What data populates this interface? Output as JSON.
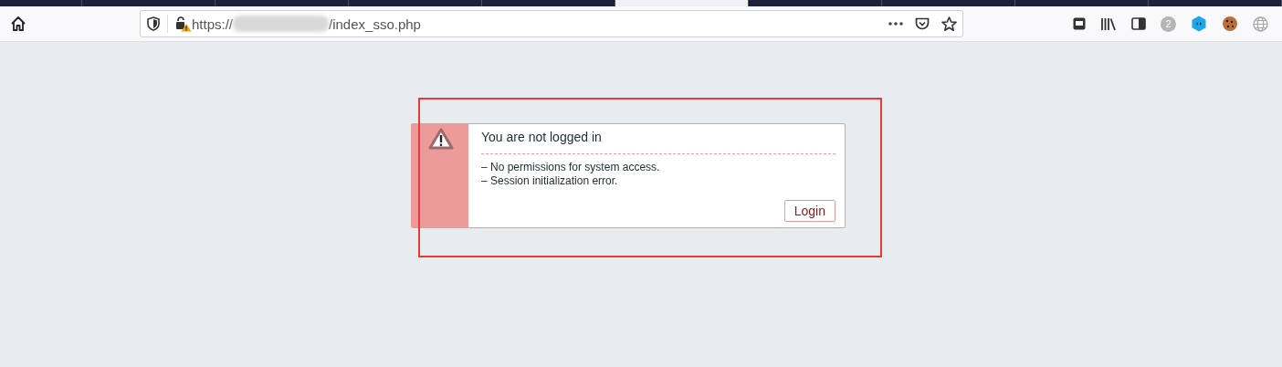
{
  "tabs": [
    {
      "selected": false
    },
    {
      "selected": false
    },
    {
      "selected": false
    },
    {
      "selected": false
    },
    {
      "selected": false
    },
    {
      "selected": true
    },
    {
      "selected": false
    },
    {
      "selected": false
    },
    {
      "selected": false
    },
    {
      "selected": false
    }
  ],
  "address_bar": {
    "url_start": "https://",
    "url_end": "/index_sso.php"
  },
  "toolbar": {
    "badge": "2"
  },
  "alert": {
    "title": "You are not logged in",
    "messages": [
      "–  No permissions for system access.",
      "–  Session initialization error."
    ],
    "button": "Login"
  }
}
